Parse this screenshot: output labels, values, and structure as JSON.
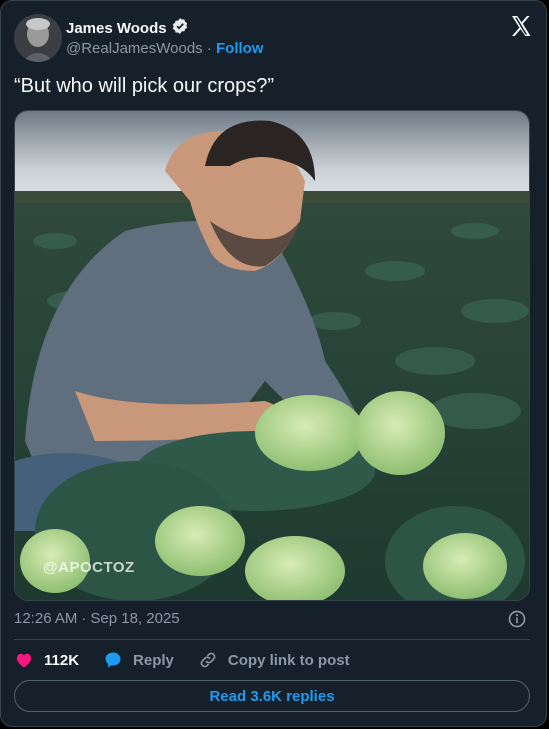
{
  "author": {
    "name": "James Woods",
    "handle": "@RealJamesWoods",
    "separator": "·",
    "follow_label": "Follow",
    "verified": true
  },
  "tweet": {
    "text": "“But who will pick our crops?”",
    "image_watermark": "@APOCTOZ",
    "time": "12:26 AM",
    "separator": "·",
    "date": "Sep 18, 2025"
  },
  "actions": {
    "like_count": "112K",
    "reply_label": "Reply",
    "copy_link_label": "Copy link to post"
  },
  "read_replies_label": "Read 3.6K replies",
  "icons": {
    "platform_logo": "x-logo-icon",
    "verified": "verified-badge-icon",
    "like": "heart-icon",
    "reply": "speech-bubble-icon",
    "copy_link": "link-icon",
    "info": "info-icon"
  },
  "colors": {
    "background": "#15202b",
    "accent": "#1d9bf0",
    "like": "#f91880",
    "muted_text": "#8b98a5"
  }
}
